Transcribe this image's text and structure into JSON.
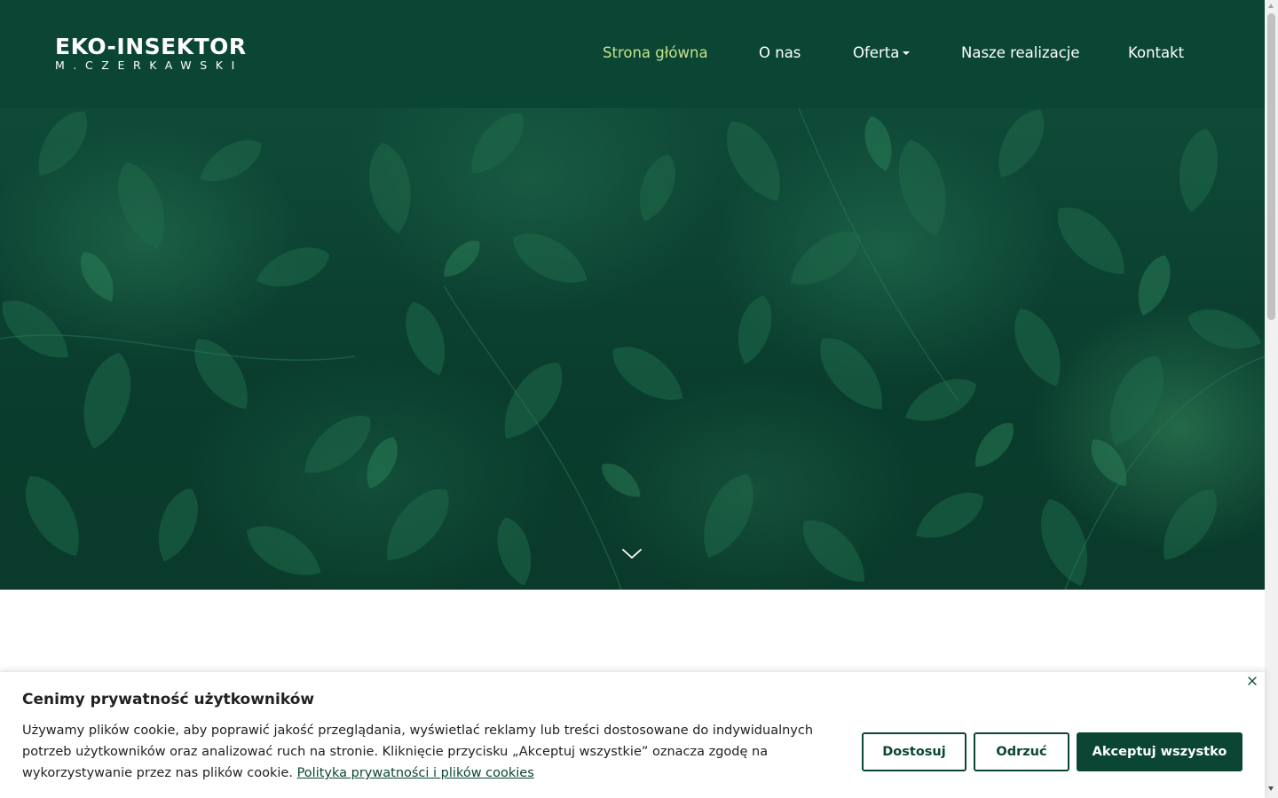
{
  "logo": {
    "main": "EKO-INSEKTOR",
    "sub": "M.CZERKAWSKI"
  },
  "nav": {
    "items": [
      {
        "label": "Strona główna",
        "active": true
      },
      {
        "label": "O nas",
        "active": false
      },
      {
        "label": "Oferta",
        "active": false,
        "has_dropdown": true
      },
      {
        "label": "Nasze realizacje",
        "active": false
      },
      {
        "label": "Kontakt",
        "active": false
      }
    ]
  },
  "hero": {
    "scroll_icon": "chevron-down-icon"
  },
  "cookie": {
    "title": "Cenimy prywatność użytkowników",
    "text": "Używamy plików cookie, aby poprawić jakość przeglądania, wyświetlać reklamy lub treści dostosowane do indywidualnych potrzeb użytkowników oraz analizować ruch na stronie. Kliknięcie przycisku „Akceptuj wszystkie” oznacza zgodę na wykorzystywanie przez nas plików cookie.",
    "link": "Polityka prywatności i plików cookies",
    "buttons": {
      "customize": "Dostosuj",
      "reject": "Odrzuć",
      "accept": "Akceptuj wszystko"
    },
    "close_icon": "close-icon"
  },
  "colors": {
    "brand": "#0b4634",
    "nav_active": "#c4e28a",
    "text": "#212121"
  }
}
